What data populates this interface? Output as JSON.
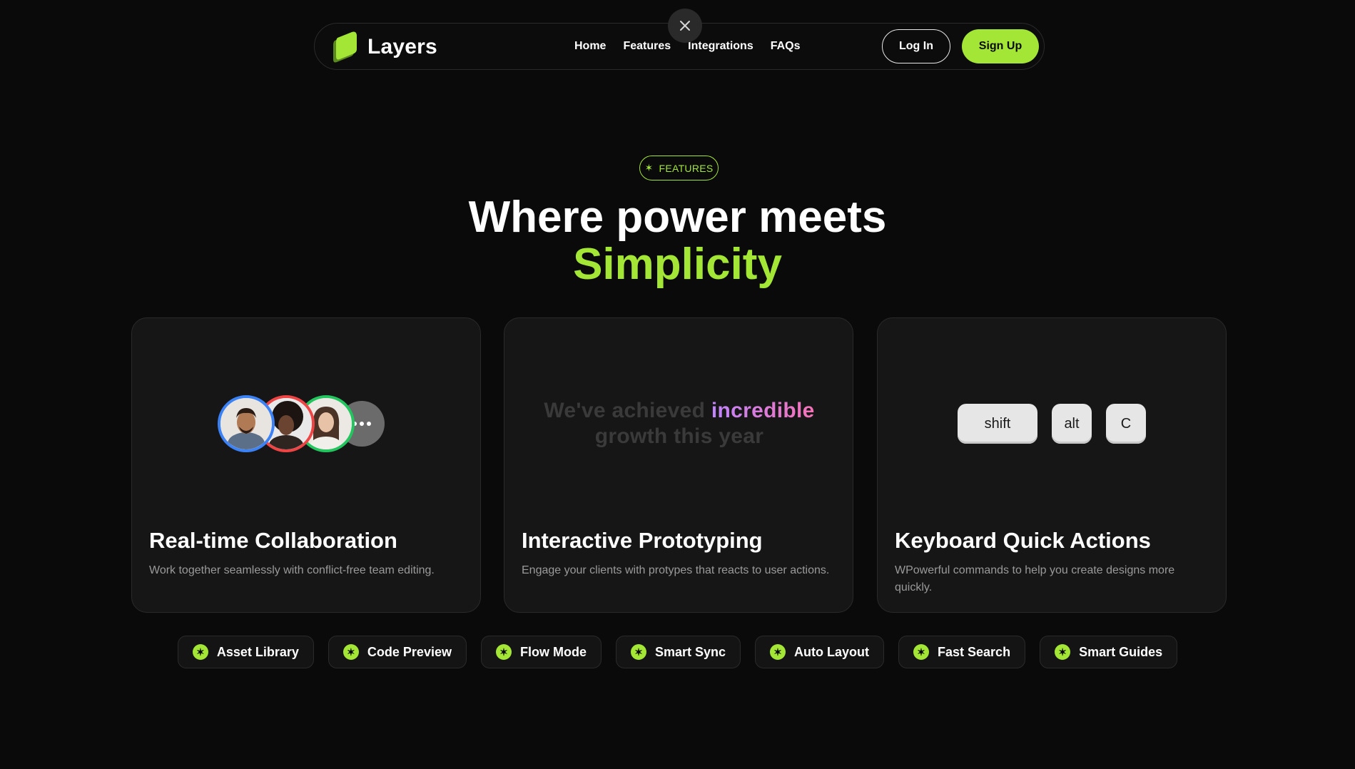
{
  "colors": {
    "background": "#0a0a0a",
    "accent": "#a3e635",
    "card": "#161616",
    "highlight_gradient": [
      "#c084fc",
      "#f472b6"
    ]
  },
  "navbar": {
    "brand": "Layers",
    "links": [
      "Home",
      "Features",
      "Integrations",
      "FAQs"
    ],
    "login_label": "Log In",
    "signup_label": "Sign Up",
    "close_icon": "close-icon"
  },
  "hero": {
    "badge": "FEATURES",
    "badge_icon": "asterisk-icon",
    "headline": "Where power meets",
    "headline_accent": "Simplicity"
  },
  "cards": [
    {
      "title": "Real-time Collaboration",
      "description": "Work together seamlessly with conflict-free team editing.",
      "avatar_ring_colors": [
        "#3b82f6",
        "#ef4444",
        "#22c55e"
      ],
      "more_icon": "more-dots-icon"
    },
    {
      "title": "Interactive Prototyping",
      "description": "Engage your clients with protypes that reacts to user actions.",
      "text_before": "We've achieved ",
      "text_highlight": "incredible",
      "text_after": "growth this year"
    },
    {
      "title": "Keyboard Quick Actions",
      "description": "WPowerful commands to help you create designs more quickly.",
      "keys": [
        "shift",
        "alt",
        "C"
      ]
    }
  ],
  "chips": [
    "Asset Library",
    "Code Preview",
    "Flow Mode",
    "Smart Sync",
    "Auto Layout",
    "Fast Search",
    "Smart Guides"
  ]
}
